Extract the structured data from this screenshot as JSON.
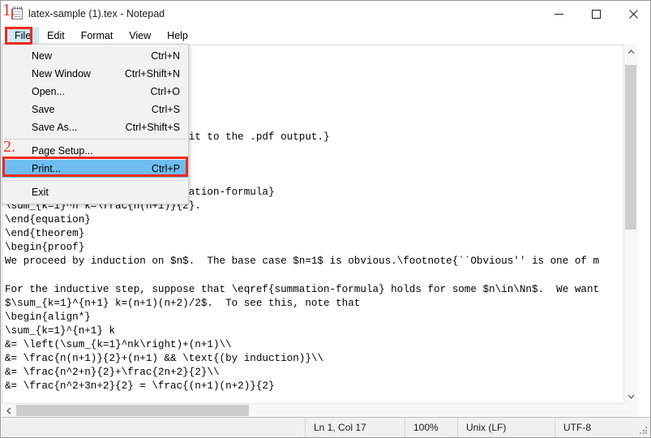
{
  "window": {
    "title": "latex-sample (1).tex - Notepad",
    "icon": "notepad-icon",
    "minimize_label": "Minimize",
    "maximize_label": "Maximize",
    "close_label": "Close"
  },
  "annotations": {
    "step_one": "1.",
    "step_two": "2.",
    "accent_color": "#ef2a1c"
  },
  "menubar": {
    "items": [
      {
        "label": "File",
        "active": true
      },
      {
        "label": "Edit",
        "active": false
      },
      {
        "label": "Format",
        "active": false
      },
      {
        "label": "View",
        "active": false
      },
      {
        "label": "Help",
        "active": false
      }
    ]
  },
  "file_menu": {
    "open": true,
    "highlight_color": "#6fbdf0",
    "items": [
      {
        "label": "New",
        "accel": "Ctrl+N",
        "selected": false,
        "separator_after": false
      },
      {
        "label": "New Window",
        "accel": "Ctrl+Shift+N",
        "selected": false,
        "separator_after": false
      },
      {
        "label": "Open...",
        "accel": "Ctrl+O",
        "selected": false,
        "separator_after": false
      },
      {
        "label": "Save",
        "accel": "Ctrl+S",
        "selected": false,
        "separator_after": false
      },
      {
        "label": "Save As...",
        "accel": "Ctrl+Shift+S",
        "selected": false,
        "separator_after": true
      },
      {
        "label": "Page Setup...",
        "accel": "",
        "selected": false,
        "separator_after": false
      },
      {
        "label": "Print...",
        "accel": "Ctrl+P",
        "selected": true,
        "separator_after": true
      },
      {
        "label": "Exit",
        "accel": "",
        "selected": false,
        "separator_after": false
      }
    ]
  },
  "editor": {
    "content": "\n\n\n\n\n\noad the .tex file and compare it to the .pdf output.}\n\n\n\n                              ation-formula}\n\\sum_{k=1}^n k=\\frac{n(n+1)}{2}.\n\\end{equation}\n\\end{theorem}\n\\begin{proof}\nWe proceed by induction on $n$.  The base case $n=1$ is obvious.\\footnote{``Obvious'' is one of m\n\nFor the inductive step, suppose that \\eqref{summation-formula} holds for some $n\\in\\Nn$.  We want\n$\\sum_{k=1}^{n+1} k=(n+1)(n+2)/2$.  To see this, note that\n\\begin{align*}\n\\sum_{k=1}^{n+1} k\n&= \\left(\\sum_{k=1}^nk\\right)+(n+1)\\\\\n&= \\frac{n(n+1)}{2}+(n+1) && \\text{(by induction)}\\\\\n&= \\frac{n^2+n}{2}+\\frac{2n+2}{2}\\\\\n&= \\frac{n^2+3n+2}{2} = \\frac{(n+1)(n+2)}{2}"
  },
  "scrollbars": {
    "vertical_up_icon": "chevron-up-icon",
    "vertical_down_icon": "chevron-down-icon",
    "horizontal_left_icon": "chevron-left-icon",
    "horizontal_right_icon": "chevron-right-icon"
  },
  "statusbar": {
    "position": "Ln 1, Col 17",
    "zoom": "100%",
    "line_ending": "Unix (LF)",
    "encoding": "UTF-8"
  }
}
